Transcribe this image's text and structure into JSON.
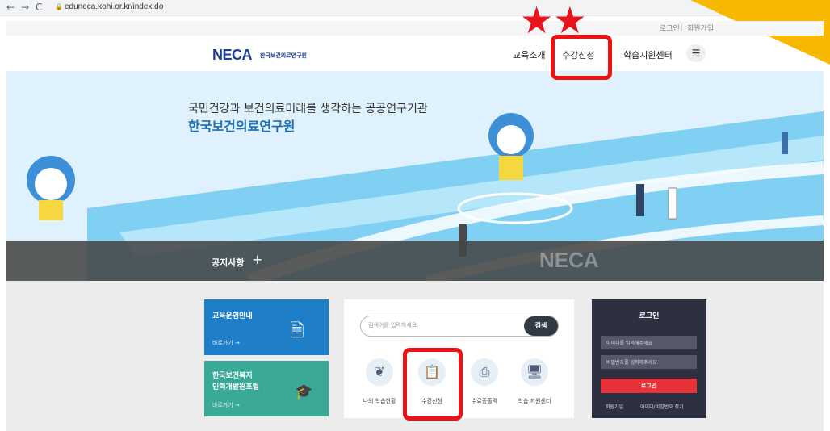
{
  "browser": {
    "url": "eduneca.kohi.or.kr/index.do"
  },
  "utility": {
    "login": "로그인",
    "signup": "회원가입"
  },
  "header": {
    "logo_main": "NECA",
    "logo_sub": "한국보건의료연구원",
    "menu": [
      "교육소개",
      "수강신청",
      "학습지원센터"
    ]
  },
  "hero": {
    "subtitle": "국민건강과 보건의료미래를 생각하는 공공연구기관",
    "title": "한국보건의료연구원",
    "notice_label": "공지사항",
    "notice_plus": "+",
    "watermark": "NECA"
  },
  "cards": [
    {
      "title": "교육운영안내",
      "more": "바로가기 →"
    },
    {
      "title": "한국보건복지\n인력개발원포털",
      "more": "바로가기 →"
    }
  ],
  "search": {
    "placeholder": "검색어를 입력하세요.",
    "button": "검색"
  },
  "quick_links": [
    {
      "label": "나의 학습현황",
      "icon": "sprout-icon"
    },
    {
      "label": "수강신청",
      "icon": "clipboard-check-icon"
    },
    {
      "label": "수료증출력",
      "icon": "printer-icon"
    },
    {
      "label": "학습 지원센터",
      "icon": "monitor-icon"
    }
  ],
  "login": {
    "title": "로그인",
    "id_placeholder": "아이디를 입력해주세요",
    "pw_placeholder": "비밀번호를 입력해주세요",
    "button": "로그인",
    "signup": "회원가입",
    "find": "아이디/비밀번호 찾기"
  },
  "annotation": {
    "stars": "★★"
  },
  "colors": {
    "accent_red": "#ee1111",
    "brand_blue": "#1b3f94",
    "card_blue": "#1e7fc8",
    "card_green": "#3aaa96",
    "login_bg": "#2c3041",
    "corner_yellow": "#f7b801"
  }
}
